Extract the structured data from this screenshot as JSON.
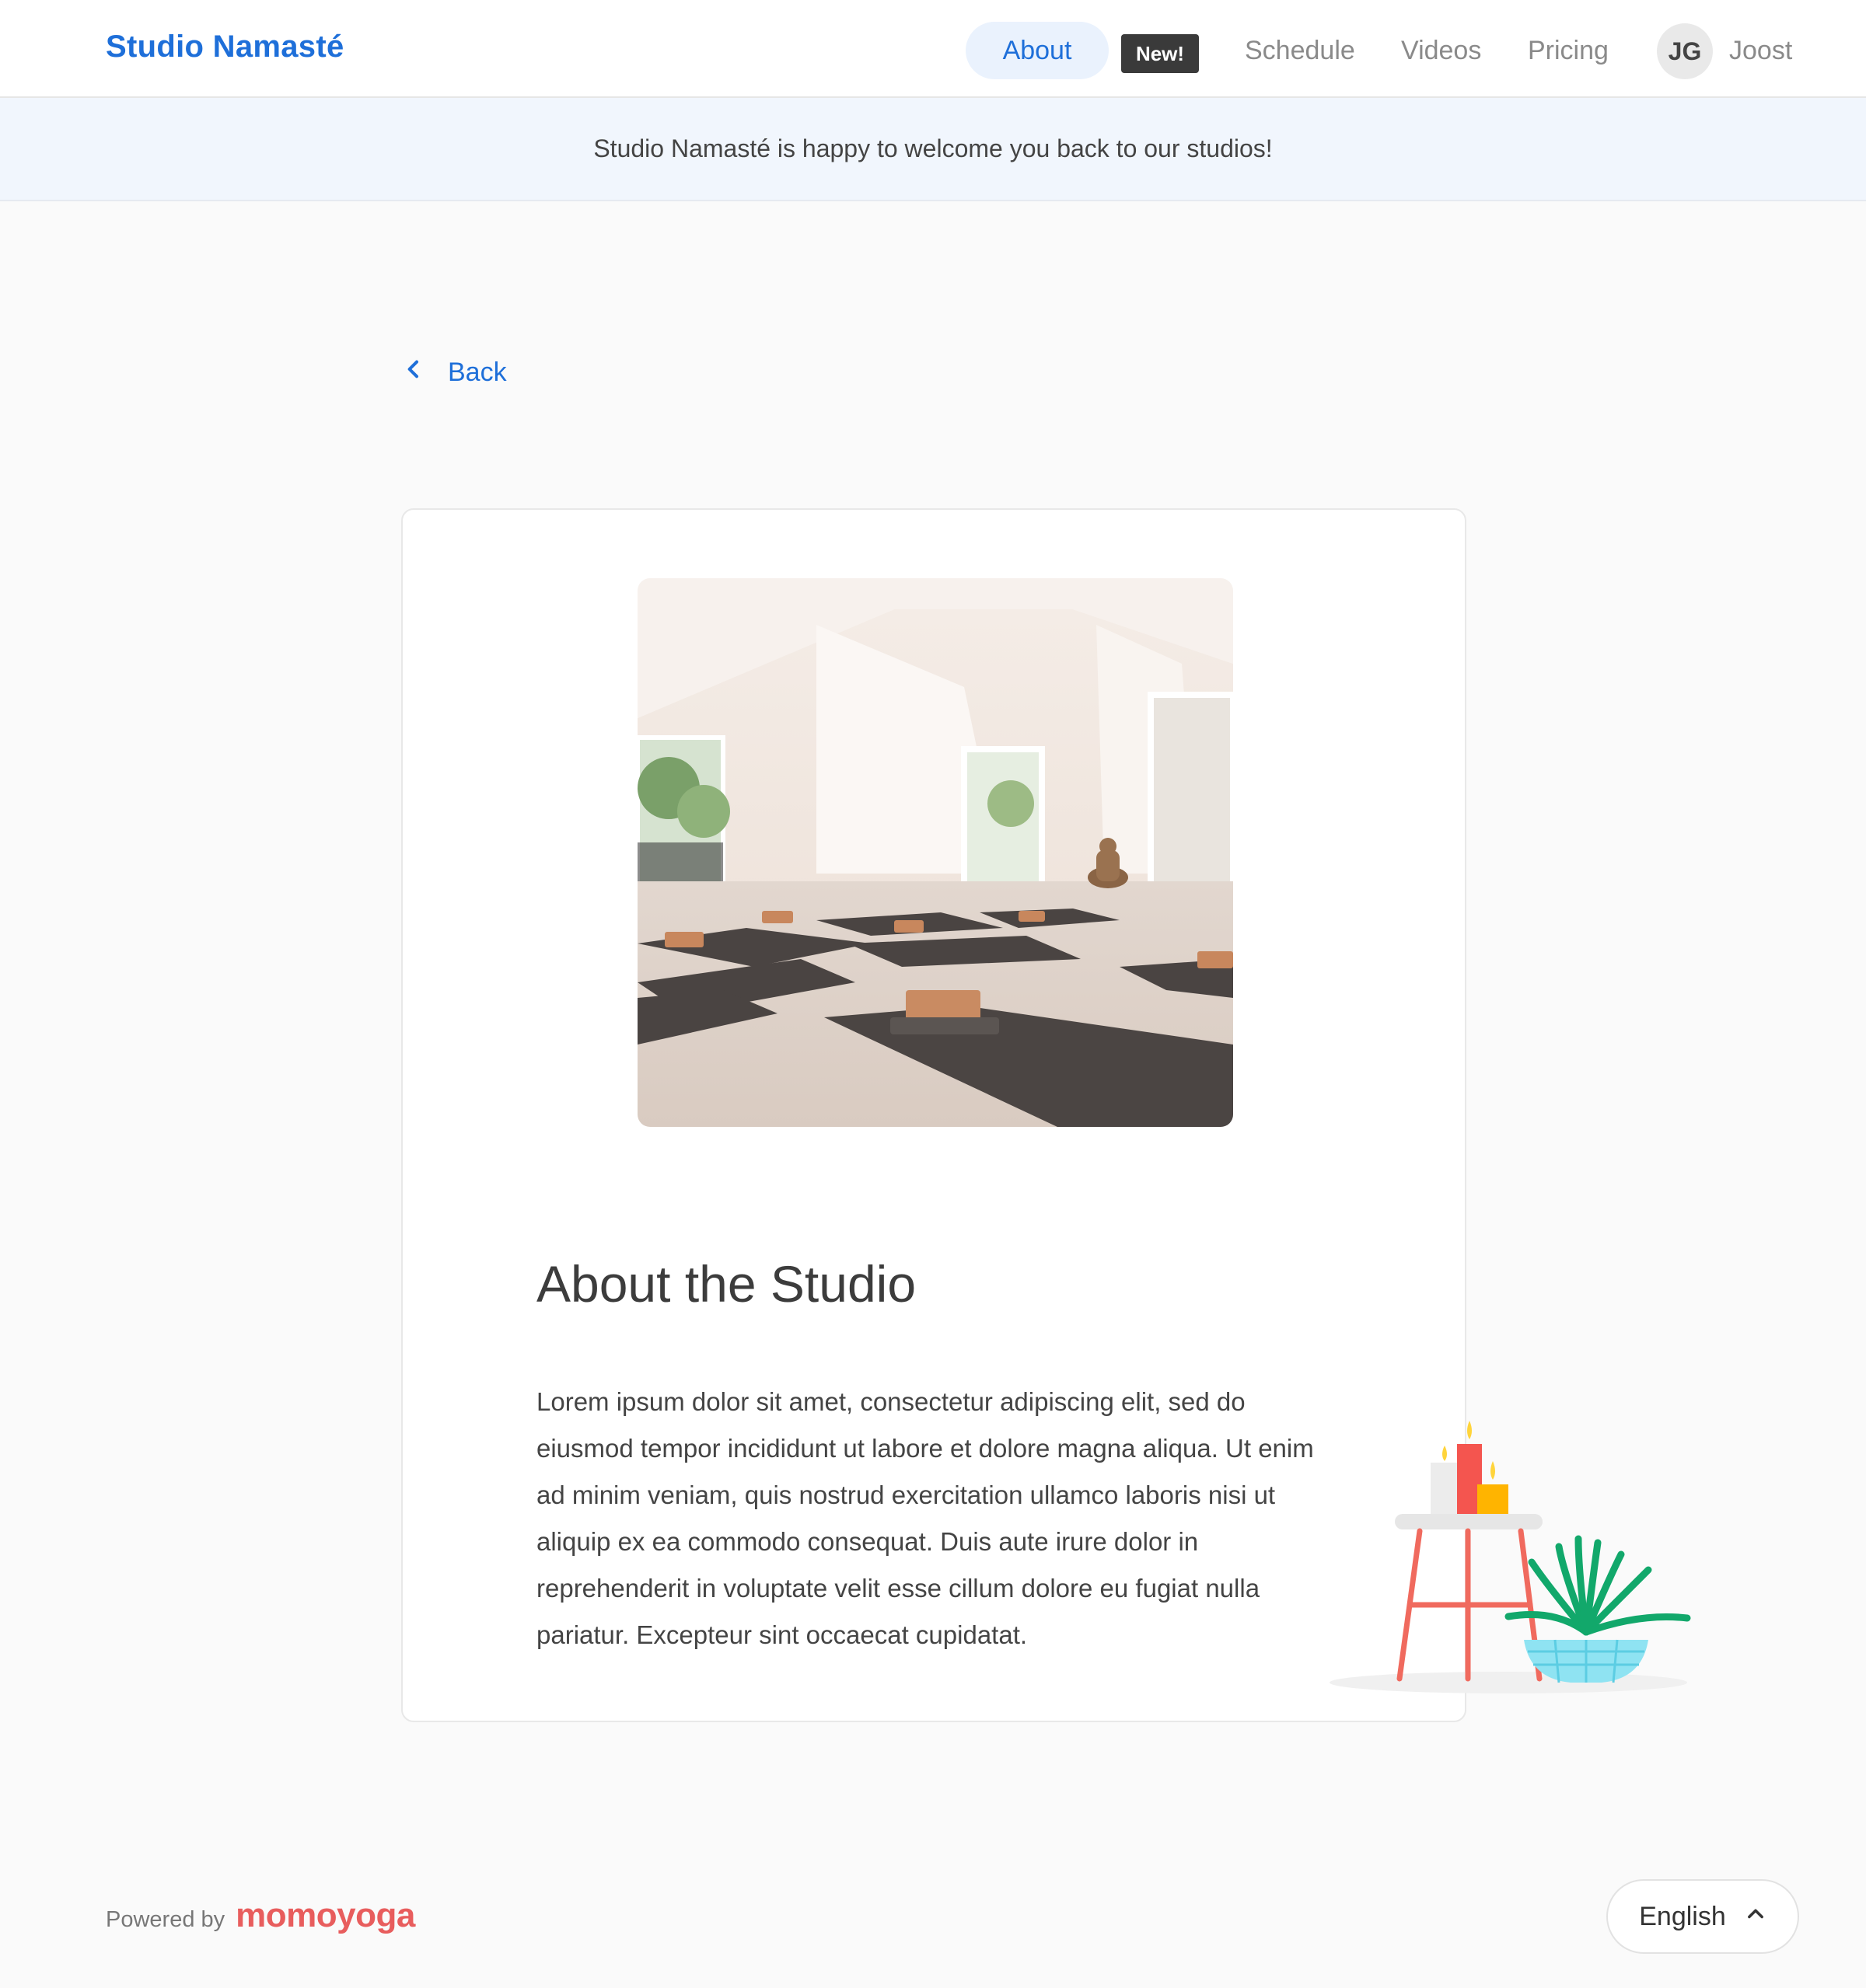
{
  "header": {
    "brand": "Studio Namasté",
    "nav": {
      "about": "About",
      "new_badge": "New!",
      "schedule": "Schedule",
      "videos": "Videos",
      "pricing": "Pricing"
    },
    "user": {
      "initials": "JG",
      "name": "Joost"
    }
  },
  "banner": {
    "text": "Studio Namasté is happy to welcome you back to our studios!"
  },
  "back": {
    "label": "Back",
    "icon": "chevron-left-icon"
  },
  "about": {
    "title": "About the Studio",
    "body": "Lorem ipsum dolor sit amet, consectetur adipiscing elit, sed do eiusmod tempor incididunt ut labore et dolore magna aliqua. Ut enim ad minim veniam, quis nostrud exercitation ullamco laboris nisi ut aliquip ex ea commodo consequat. Duis aute irure dolor in reprehenderit in voluptate velit esse cillum dolore eu fugiat nulla pariatur. Excepteur sint occaecat cupidatat."
  },
  "footer": {
    "powered_by": "Powered by",
    "logo": "momoyoga",
    "language": "English",
    "language_icon": "chevron-up-icon"
  },
  "colors": {
    "accent": "#1e6fd9",
    "brand_logo": "#e85d5d",
    "badge": "#3a3a3a"
  }
}
